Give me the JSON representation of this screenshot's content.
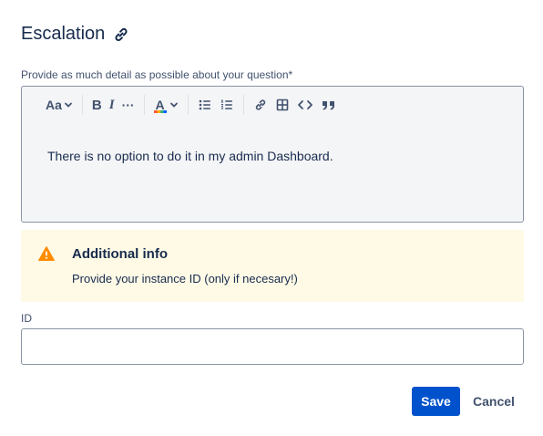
{
  "dialog": {
    "title": "Escalation",
    "title_icon": "link-icon"
  },
  "description_field": {
    "label": "Provide as much detail as possible about your question*",
    "content": "There is no option to do it in my admin Dashboard."
  },
  "toolbar": {
    "text_style_label": "Aa",
    "bold_label": "B",
    "italic_label": "I",
    "more_label": "···",
    "text_color_label": "A",
    "icons": [
      "chevron-down-icon",
      "bullet-list-icon",
      "numbered-list-icon",
      "link-icon",
      "table-icon",
      "code-icon",
      "quote-icon"
    ]
  },
  "info_panel": {
    "icon": "warning-icon",
    "title": "Additional info",
    "text": "Provide your instance ID (only if necesary!)",
    "background": "#fffae6",
    "icon_color": "#ff8b00"
  },
  "id_field": {
    "label": "ID",
    "value": "",
    "placeholder": ""
  },
  "actions": {
    "save_label": "Save",
    "cancel_label": "Cancel",
    "primary_color": "#0052cc"
  }
}
